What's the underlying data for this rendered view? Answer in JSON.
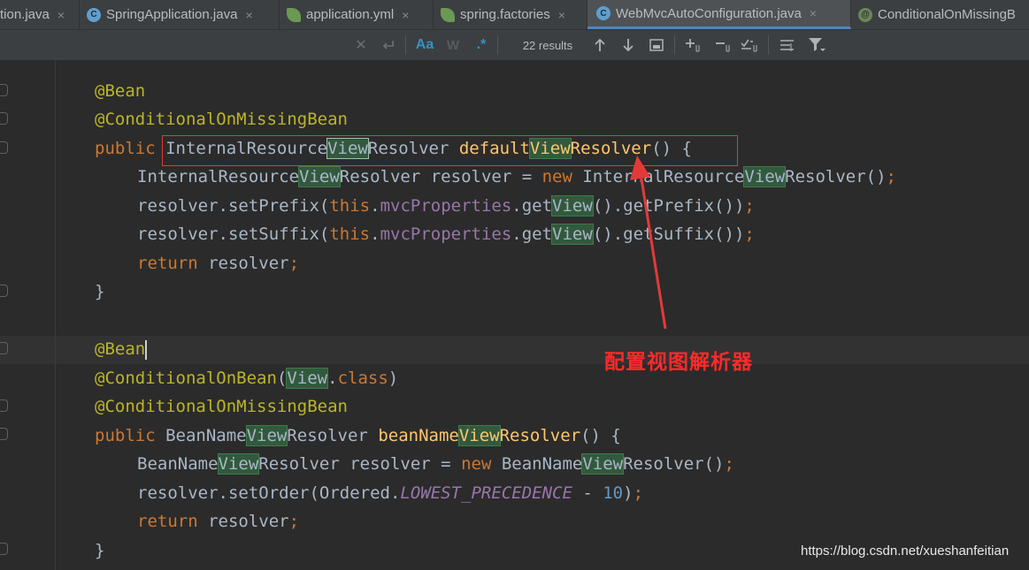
{
  "tabs": [
    {
      "label": "tion.java",
      "icon": "none"
    },
    {
      "label": "SpringApplication.java",
      "icon": "class-c-icon"
    },
    {
      "label": "application.yml",
      "icon": "spring-leaf-icon"
    },
    {
      "label": "spring.factories",
      "icon": "spring-leaf-icon"
    },
    {
      "label": "WebMvcAutoConfiguration.java",
      "icon": "class-c-icon",
      "active": true
    },
    {
      "label": "ConditionalOnMissingB",
      "icon": "annotation-icon"
    }
  ],
  "tab_close_glyph": "×",
  "search": {
    "match_case": "Aa",
    "words": "W",
    "regex": ".*",
    "results": "22 results"
  },
  "editor": {
    "current_match": "View"
  },
  "annotation": {
    "note": "配置视图解析器",
    "color": "#ff2a2a"
  },
  "watermark": "https://blog.csdn.net/xueshanfeitian"
}
